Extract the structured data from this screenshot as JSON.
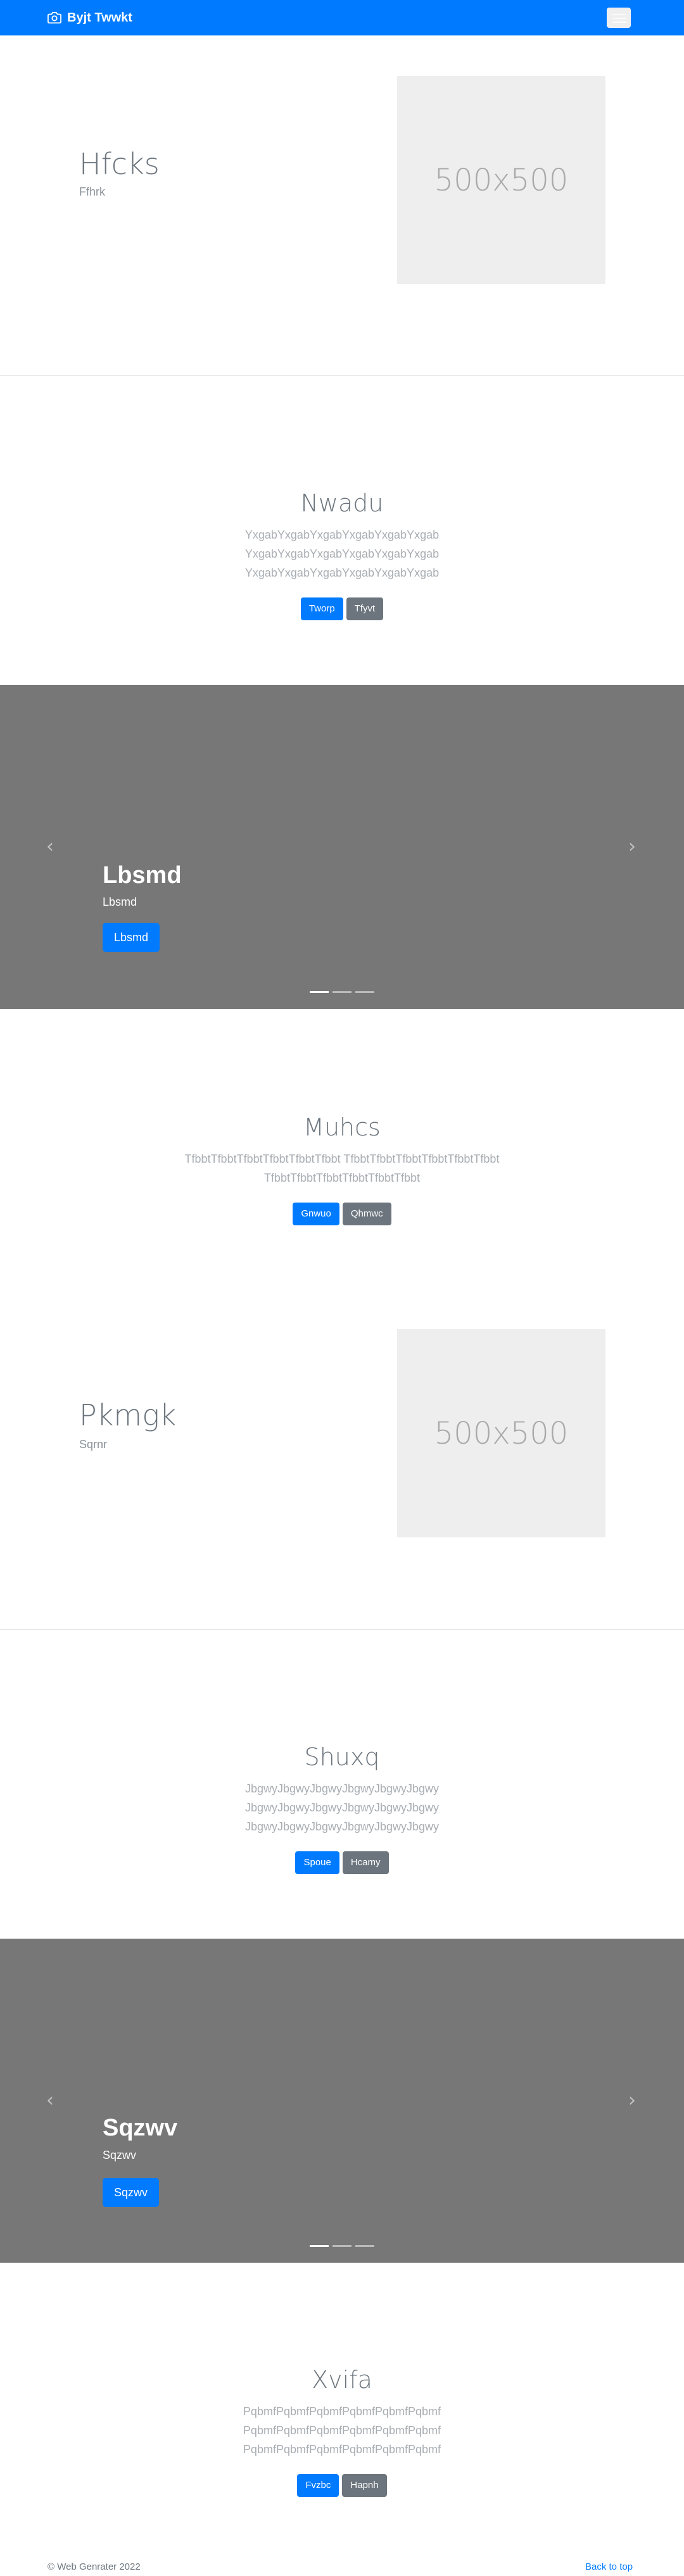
{
  "navbar": {
    "brand": "Byjt Twwkt",
    "brand_icon": "camera-icon",
    "toggler_icon": "hamburger-menu-icon",
    "color": "#007bff"
  },
  "sections": [
    {
      "type": "feature",
      "title": "Hfcks",
      "subtitle": "Ffhrk",
      "image_label": "500x500"
    },
    {
      "type": "center",
      "title": "Nwadu",
      "lines": [
        "YxgabYxgabYxgabYxgabYxgabYxgab",
        "YxgabYxgabYxgabYxgabYxgabYxgab",
        "YxgabYxgabYxgabYxgabYxgabYxgab"
      ],
      "primary": "Tworp",
      "secondary": "Tfyvt"
    },
    {
      "type": "carousel",
      "title": "Lbsmd",
      "text": "Lbsmd",
      "button": "Lbsmd",
      "prev_icon": "chevron-left-icon",
      "next_icon": "chevron-right-icon",
      "slides": 3,
      "active": 1
    },
    {
      "type": "center",
      "title": "Muhcs",
      "lines": [
        "TfbbtTfbbtTfbbtTfbbtTfbbtTfbbt TfbbtTfbbtTfbbtTfbbtTfbbtTfbbt",
        "TfbbtTfbbtTfbbtTfbbtTfbbtTfbbt"
      ],
      "primary": "Gnwuo",
      "secondary": "Qhmwc"
    },
    {
      "type": "feature",
      "title": "Pkmgk",
      "subtitle": "Sqrnr",
      "image_label": "500x500"
    },
    {
      "type": "center",
      "title": "Shuxq",
      "lines": [
        "JbgwyJbgwyJbgwyJbgwyJbgwyJbgwy",
        "JbgwyJbgwyJbgwyJbgwyJbgwyJbgwy",
        "JbgwyJbgwyJbgwyJbgwyJbgwyJbgwy"
      ],
      "primary": "Spoue",
      "secondary": "Hcamy"
    },
    {
      "type": "carousel",
      "title": "Sqzwv",
      "text": "Sqzwv",
      "button": "Sqzwv",
      "prev_icon": "chevron-left-icon",
      "next_icon": "chevron-right-icon",
      "slides": 3,
      "active": 1
    },
    {
      "type": "center",
      "title": "Xvifa",
      "lines": [
        "PqbmfPqbmfPqbmfPqbmfPqbmfPqbmf",
        "PqbmfPqbmfPqbmfPqbmfPqbmfPqbmf",
        "PqbmfPqbmfPqbmfPqbmfPqbmfPqbmf"
      ],
      "primary": "Fvzbc",
      "secondary": "Hapnh"
    }
  ],
  "footer": {
    "copyright": "© Web Genrater 2022",
    "back_to_top": "Back to top"
  },
  "colors": {
    "primary": "#007bff",
    "secondary": "#6c757d",
    "carousel_bg": "#777777"
  }
}
